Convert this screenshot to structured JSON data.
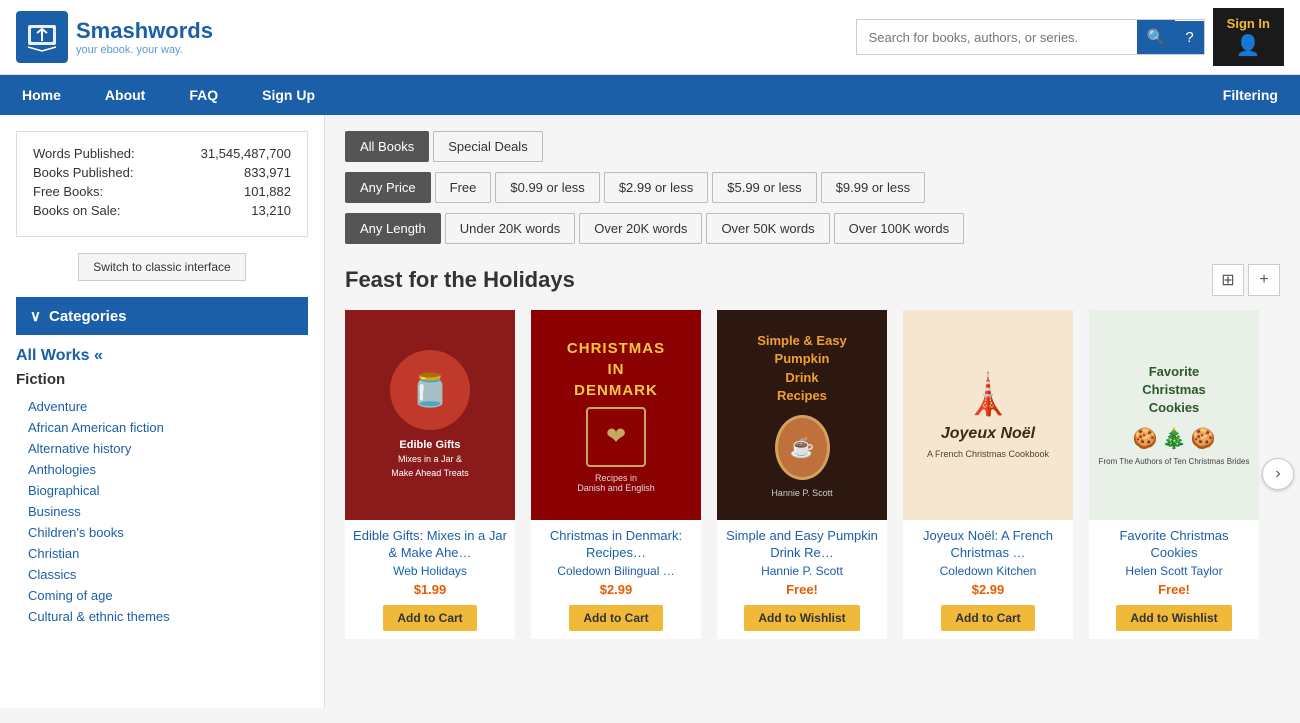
{
  "header": {
    "logo_brand": "Smashwords",
    "logo_tm": "™",
    "logo_tagline": "your ebook. your way.",
    "search_placeholder": "Search for books, authors, or series.",
    "signin_label": "Sign In"
  },
  "nav": {
    "items": [
      {
        "label": "Home",
        "key": "home"
      },
      {
        "label": "About",
        "key": "about"
      },
      {
        "label": "FAQ",
        "key": "faq"
      },
      {
        "label": "Sign Up",
        "key": "signup"
      }
    ],
    "filtering": "Filtering"
  },
  "sidebar": {
    "stats": [
      {
        "label": "Words Published:",
        "value": "31,545,487,700"
      },
      {
        "label": "Books Published:",
        "value": "833,971"
      },
      {
        "label": "Free Books:",
        "value": "101,882"
      },
      {
        "label": "Books on Sale:",
        "value": "13,210"
      }
    ],
    "switch_btn": "Switch to classic interface",
    "categories_title": "Categories",
    "all_works": "All Works «",
    "fiction": "Fiction",
    "categories": [
      "Adventure",
      "African American fiction",
      "Alternative history",
      "Anthologies",
      "Biographical",
      "Business",
      "Children's books",
      "Christian",
      "Classics",
      "Coming of age",
      "Cultural & ethnic themes"
    ]
  },
  "filters": {
    "tabs": [
      {
        "label": "All Books",
        "active": true
      },
      {
        "label": "Special Deals",
        "active": false
      }
    ],
    "price": [
      {
        "label": "Any Price",
        "active": true
      },
      {
        "label": "Free",
        "active": false
      },
      {
        "label": "$0.99 or less",
        "active": false
      },
      {
        "label": "$2.99 or less",
        "active": false
      },
      {
        "label": "$5.99 or less",
        "active": false
      },
      {
        "label": "$9.99 or less",
        "active": false
      }
    ],
    "length": [
      {
        "label": "Any Length",
        "active": true
      },
      {
        "label": "Under 20K words",
        "active": false
      },
      {
        "label": "Over 20K words",
        "active": false
      },
      {
        "label": "Over 50K words",
        "active": false
      },
      {
        "label": "Over 100K words",
        "active": false
      }
    ]
  },
  "section": {
    "title": "Feast for the Holidays"
  },
  "books": [
    {
      "title": "Edible Gifts: Mixes in a Jar & Make Ahe…",
      "author": "Web Holidays",
      "price": "$1.99",
      "btn_label": "Add to Cart",
      "cover_text": "Edible Gifts",
      "cover_sub": "Mixes in a Jar & Make Ahead Treats",
      "cover_color": "#8B1A1A"
    },
    {
      "title": "Christmas in Denmark: Recipes…",
      "author": "Coledown Bilingual …",
      "price": "$2.99",
      "btn_label": "Add to Cart",
      "cover_text": "CHRISTMAS IN DENMARK",
      "cover_sub": "Recipes in Danish and English",
      "cover_color": "#8B0000"
    },
    {
      "title": "Simple and Easy Pumpkin Drink Re…",
      "author": "Hannie P. Scott",
      "price": "Free!",
      "btn_label": "Add to Wishlist",
      "cover_text": "Simple & Easy Pumpkin Drink Recipes",
      "cover_sub": "",
      "cover_color": "#2c1810"
    },
    {
      "title": "Joyeux Noël: A French Christmas …",
      "author": "Coledown Kitchen",
      "price": "$2.99",
      "btn_label": "Add to Cart",
      "cover_text": "Joyeux Noël",
      "cover_sub": "A French Christmas Cookbook",
      "cover_color": "#f5e6d0"
    },
    {
      "title": "Favorite Christmas Cookies",
      "author": "Helen Scott Taylor",
      "price": "Free!",
      "btn_label": "Add to Wishlist",
      "cover_text": "Favorite Christmas Cookies",
      "cover_sub": "",
      "cover_color": "#e8f4e8"
    }
  ]
}
